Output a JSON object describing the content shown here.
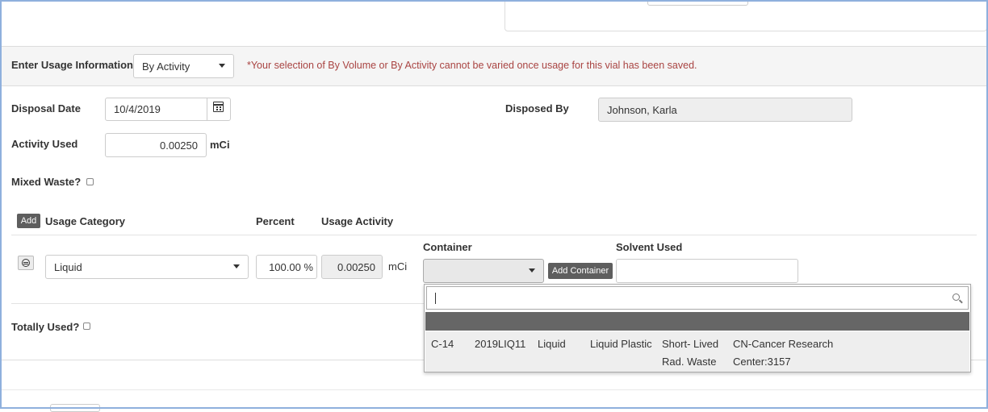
{
  "usage": {
    "label": "Enter Usage Information",
    "mode_selected": "By Activity",
    "warning": "*Your selection of By Volume or By Activity cannot be varied once usage for this vial has been saved."
  },
  "disposal": {
    "date_label": "Disposal Date",
    "date_value": "10/4/2019",
    "disposed_by_label": "Disposed By",
    "disposed_by_value": "Johnson, Karla"
  },
  "activity": {
    "label": "Activity Used",
    "value": "0.00250",
    "unit": "mCi"
  },
  "mixed_waste": {
    "label": "Mixed Waste?",
    "checked": false
  },
  "category_table": {
    "add_label": "Add",
    "headers": {
      "category": "Usage Category",
      "percent": "Percent",
      "activity": "Usage Activity",
      "container": "Container",
      "solvent": "Solvent Used"
    },
    "row": {
      "category": "Liquid",
      "percent": "100.00 %",
      "activity": "0.00250",
      "unit": "mCi",
      "container_value": "",
      "add_container_label": "Add Container",
      "solvent_value": ""
    }
  },
  "totally_used": {
    "label": "Totally Used?",
    "checked": false
  },
  "container_dropdown": {
    "search_value": "",
    "options": [
      {
        "isotope": "C-14",
        "code": "2019LIQ11",
        "form": "Liquid",
        "type": "Liquid Plastic",
        "waste_line1": "Short- Lived",
        "waste_line2": "Rad. Waste",
        "location_line1": "CN-Cancer Research",
        "location_line2": "Center:3157"
      }
    ]
  },
  "icons": {
    "calendar": "calendar-icon",
    "caret": "caret-down-icon",
    "remove": "remove-circle-icon",
    "search": "search-icon"
  },
  "colors": {
    "warning": "#a94442",
    "dark_button": "#5e5e5e",
    "band_background": "#f5f5f5",
    "frame": "#8fb0dd"
  }
}
